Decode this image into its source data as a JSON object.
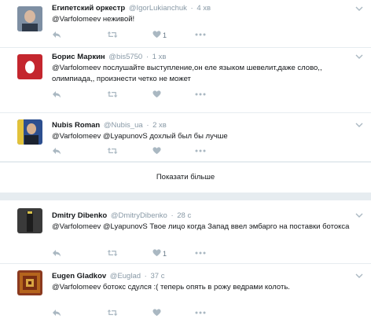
{
  "tweets": [
    {
      "name": "Египетский оркестр",
      "handle": "@IgorLukianchuk",
      "separator": "·",
      "time": "4 хв",
      "mention": "@Varfolomeev",
      "text": " неживой!",
      "likes": "1",
      "colors": {
        "avatar_bg": "#6b7a8c"
      }
    },
    {
      "name": "Борис Маркин",
      "handle": "@bis5750",
      "separator": "·",
      "time": "1 хв",
      "mention": "@Varfolomeev",
      "text": " послушайте выступление,он еле языком шевелит,даже слово,, олимпиада,, произнести четко не может",
      "likes": "",
      "colors": {
        "avatar_bg": "#c4262e"
      }
    },
    {
      "name": "Nubis Roman",
      "handle": "@Nubis_ua",
      "separator": "·",
      "time": "2 хв",
      "mention": "@Varfolomeev @LyapunovS",
      "text": " дохлый был бы лучше",
      "likes": "",
      "colors": {
        "avatar_bg": "#2a4a8a"
      }
    },
    {
      "name": "Dmitry Dibenko",
      "handle": "@DmitryDibenko",
      "separator": "·",
      "time": "28 с",
      "mention": "@Varfolomeev @LyapunovS",
      "text": " Твое лицо когда Запад ввел эмбарго на поставки ботокса",
      "likes": "1",
      "colors": {
        "avatar_bg": "#2b2b2b"
      }
    },
    {
      "name": "Eugen Gladkov",
      "handle": "@Euglad",
      "separator": "·",
      "time": "37 с",
      "mention": "@Varfolomeev",
      "text": " ботокс сдулся :( теперь опять в рожу ведрами колоть.",
      "likes": "",
      "colors": {
        "avatar_bg": "#a0522d"
      }
    }
  ],
  "show_more": "Показати більше",
  "icons": {
    "reply": "reply-icon",
    "retweet": "retweet-icon",
    "like": "heart-icon",
    "more": "more-dots-icon",
    "caret": "chevron-down-icon"
  }
}
